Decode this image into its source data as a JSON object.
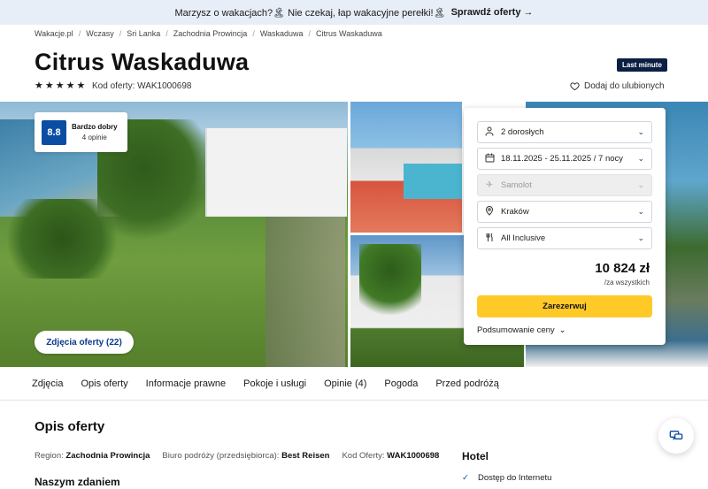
{
  "promo": {
    "text": "Marzysz o wakacjach?🏝 Nie czekaj, łap wakacyjne perełki!🏝",
    "cta": "Sprawdź oferty →"
  },
  "breadcrumb": [
    "Wakacje.pl",
    "Wczasy",
    "Sri Lanka",
    "Zachodnia Prowincja",
    "Waskaduwa",
    "Citrus Waskaduwa"
  ],
  "hotel": {
    "name": "Citrus Waskaduwa",
    "badge": "Last minute",
    "stars": 5,
    "offer_code_label": "Kod oferty: WAK1000698",
    "favorite_label": "Dodaj do ulubionych"
  },
  "rating": {
    "score": "8.8",
    "label": "Bardzo dobry",
    "reviews": "4 opinie"
  },
  "gallery": {
    "photos_button": "Zdjęcia oferty (22)"
  },
  "booking": {
    "travelers": "2 dorosłych",
    "dates": "18.11.2025 - 25.11.2025 / 7 nocy",
    "transport": "Samolot",
    "departure": "Kraków",
    "board": "All Inclusive",
    "price": "10 824 zł",
    "price_note": "/za wszystkich",
    "reserve_label": "Zarezerwuj",
    "summary_label": "Podsumowanie ceny"
  },
  "tabs": [
    "Zdjęcia",
    "Opis oferty",
    "Informacje prawne",
    "Pokoje i usługi",
    "Opinie (4)",
    "Pogoda",
    "Przed podróżą"
  ],
  "description": {
    "title": "Opis oferty",
    "region_label": "Region:",
    "region_value": "Zachodnia Prowincja",
    "agency_label": "Biuro podróży (przedsiębiorca):",
    "agency_value": "Best Reisen",
    "code_label": "Kod Oferty:",
    "code_value": "WAK1000698",
    "subsection": "Naszym zdaniem"
  },
  "hotel_section": {
    "title": "Hotel",
    "amenity": "Dostęp do Internetu"
  },
  "colors": {
    "primary": "#0a4da2",
    "accent": "#ffc928",
    "badge": "#0b1f44"
  }
}
